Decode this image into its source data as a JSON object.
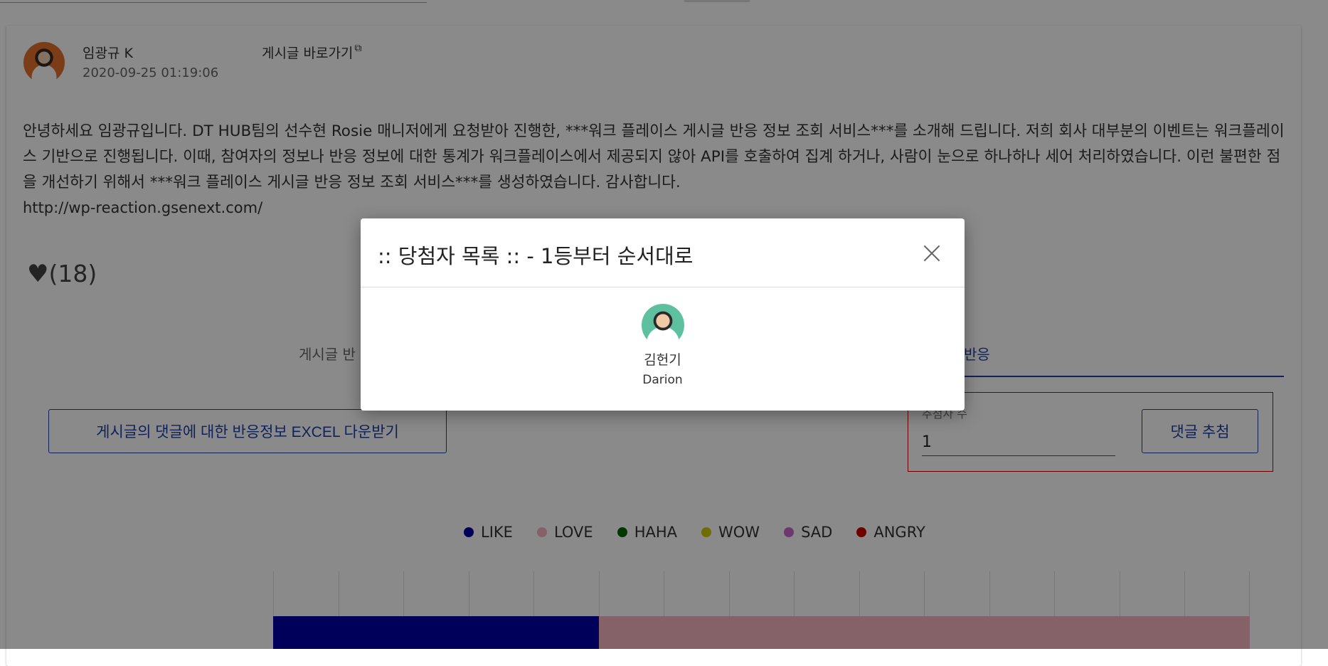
{
  "post": {
    "author": "임광규 K",
    "date": "2020-09-25 01:19:06",
    "link_label": "게시글 바로가기",
    "body": "안녕하세요 임광규입니다. DT HUB팀의 선수현 Rosie 매니저에게 요청받아 진행한, ***워크 플레이스 게시글 반응 정보 조회 서비스***를 소개해 드립니다. 저희 회사 대부분의 이벤트는 워크플레이스 기반으로 진행됩니다. 이때, 참여자의 정보나 반응 정보에 대한 통계가 워크플레이스에서 제공되지 않아 API를 호출하여 집계 하거나, 사람이 눈으로 하나하나 세어 처리하였습니다. 이런 불편한 점을 개선하기 위해서 ***워크 플레이스 게시글 반응 정보 조회 서비스***를 생성하였습니다. 감사합니다.",
    "url": "http://wp-reaction.gsenext.com/",
    "like_count": "(18)"
  },
  "tabs": {
    "left": "게시글 반",
    "right": "반응"
  },
  "actions": {
    "excel_button": "게시글의 댓글에 대한 반응정보 EXCEL 다운받기",
    "draw_count_label": "추첨자 수",
    "draw_count_value": "1",
    "draw_button": "댓글 추첨"
  },
  "legend": [
    {
      "label": "LIKE",
      "color": "#0000a8"
    },
    {
      "label": "LOVE",
      "color": "#f5b3c0"
    },
    {
      "label": "HAHA",
      "color": "#006400"
    },
    {
      "label": "WOW",
      "color": "#cccc00"
    },
    {
      "label": "SAD",
      "color": "#cc66cc"
    },
    {
      "label": "ANGRY",
      "color": "#cc0000"
    }
  ],
  "chart_data": {
    "type": "bar",
    "orientation": "horizontal-stacked",
    "series": [
      {
        "name": "LIKE",
        "values": [
          5
        ]
      },
      {
        "name": "LOVE",
        "values": [
          10
        ]
      }
    ],
    "xlim": [
      0,
      15
    ],
    "grid": true
  },
  "modal": {
    "title": ":: 당첨자 목록 :: - 1등부터 순서대로",
    "winner_name": "김헌기",
    "winner_en_name": "Darion"
  }
}
